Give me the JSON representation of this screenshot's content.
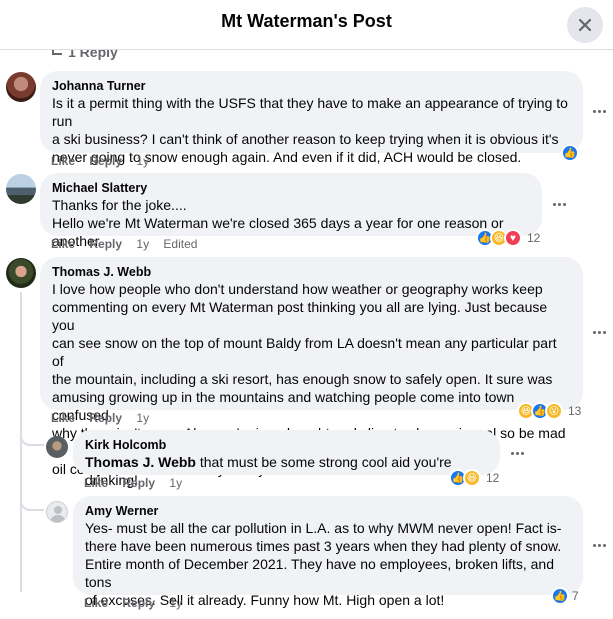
{
  "header": {
    "title": "Mt Waterman's Post"
  },
  "previous_replies": "1 Reply",
  "icons": {
    "close": "close-icon",
    "more": "more-options-icon",
    "like_reaction": "like-reaction-icon",
    "haha_reaction": "haha-reaction-icon",
    "love_reaction": "love-reaction-icon",
    "wow_reaction": "wow-reaction-icon"
  },
  "colors": {
    "like": "#1877f2",
    "haha": "#f7b928",
    "love": "#f33e58",
    "bubble": "#f0f2f5",
    "secondary_text": "#65676b"
  },
  "comments": [
    {
      "author": "Johanna Turner",
      "lines": [
        "Is it a permit thing with the USFS that they have to make an appearance of trying to run",
        "a ski business? I can't think of another reason to keep trying when it is obvious it's",
        "never going to snow enough again. And even if it did, ACH would be closed."
      ],
      "like": "Like",
      "reply": "Reply",
      "time": "1y",
      "reaction_count": ""
    },
    {
      "author": "Michael Slattery",
      "lines": [
        "Thanks for the joke....",
        "Hello we're Mt Waterman we're closed 365 days a year for one reason or another"
      ],
      "like": "Like",
      "reply": "Reply",
      "time": "1y",
      "edited": "Edited",
      "reaction_count": "12"
    },
    {
      "author": "Thomas J. Webb",
      "lines": [
        "I love how people who don't understand how weather or geography works keep",
        "commenting on every Mt Waterman post thinking you all are lying. Just because you",
        "can see snow on the top of mount Baldy from LA doesn't mean any particular part of",
        "the mountain, including a ski resort, has enough snow to safely open. It sure was",
        "amusing growing up in the mountains and watching people come into town confused",
        "why there isn't snow. Also, we're in a drought and climate change is real so be mad at",
        "oil companies not some tiny family owned business."
      ],
      "like": "Like",
      "reply": "Reply",
      "time": "1y",
      "reaction_count": "13"
    },
    {
      "author": "Kirk Holcomb",
      "mention": "Thomas J. Webb",
      "text": " that must be some strong cool aid you're drinking!",
      "like": "Like",
      "reply": "Reply",
      "time": "1y",
      "reaction_count": "12"
    },
    {
      "author": "Amy Werner",
      "lines": [
        "Yes- must be all the car pollution in L.A. as to why MWM never open! Fact is-",
        "there have been numerous times past 3 years when they had plenty of snow.",
        "Entire month of December 2021. They have no employees, broken lifts, and tons",
        "of excuses. Sell it already. Funny how Mt. High open a lot!"
      ],
      "like": "Like",
      "reply": "Reply",
      "time": "1y",
      "reaction_count": "7"
    }
  ]
}
